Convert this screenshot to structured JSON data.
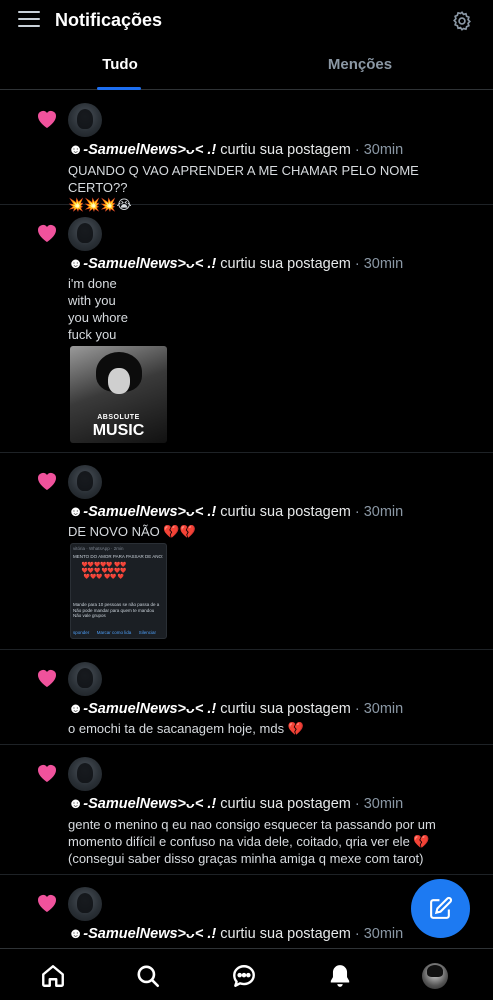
{
  "header": {
    "title": "Notificações",
    "menu_icon": "hamburger-menu-icon",
    "settings_icon": "gear-icon"
  },
  "tabs": [
    {
      "label": "Tudo",
      "active": true
    },
    {
      "label": "Menções",
      "active": false
    }
  ],
  "notifications": [
    {
      "user": "☻-SamuelNews˃ᴗ˂ .!",
      "action": " curtiu sua postagem",
      "time": " · 30min",
      "text": "QUANDO Q VAO APRENDER A ME CHAMAR PELO NOME CERTO??\n💥💥💥😭"
    },
    {
      "user": "☻-SamuelNews˃ᴗ˂ .!",
      "action": " curtiu sua postagem",
      "time": " · 30min",
      "text": "i'm done\nwith you\nyou whore\nfuck you",
      "media": {
        "small": "ABSOLUTE",
        "big": "MUSIC"
      }
    },
    {
      "user": "☻-SamuelNews˃ᴗ˂ .!",
      "action": " curtiu sua postagem",
      "time": " · 30min",
      "text": "DE NOVO NÃO 💔💔",
      "media": {
        "header": "vitória · WhatsApp · 2min",
        "line1": "MENTO DO AMOR PARA PASSAR DE ANO:",
        "hearts": "❤️❤️❤️❤️❤️ ❤️❤️❤️❤️❤️ ❤️❤️❤️❤️ ❤️❤️❤️ ❤️❤️ ❤️",
        "line2": "Mande para 10 pessoas se não passa de a\nNão pode mandar para quem te mandou\nNão vale grupos",
        "actions": "sponder      Marcar como lida      Silenciar"
      }
    },
    {
      "user": "☻-SamuelNews˃ᴗ˂ .!",
      "action": " curtiu sua postagem",
      "time": " · 30min",
      "text": "o emochi ta de sacanagem hoje, mds 💔"
    },
    {
      "user": "☻-SamuelNews˃ᴗ˂ .!",
      "action": " curtiu sua postagem",
      "time": " · 30min",
      "text": "gente o menino q eu nao consigo esquecer ta passando por um momento difícil e confuso na vida dele, coitado, qria ver ele 💔 (consegui saber disso graças minha amiga q mexe com tarot)"
    },
    {
      "user": "☻-SamuelNews˃ᴗ˂ .!",
      "action": " curtiu sua postagem",
      "time": " · 30min",
      "text": ""
    }
  ],
  "bottom_nav": [
    "home-icon",
    "search-icon",
    "chat-icon",
    "bell-icon",
    "profile-avatar"
  ],
  "fab_icon": "compose-icon",
  "colors": {
    "accent": "#1d7af2",
    "heart": "#f0529c",
    "background": "#000000"
  }
}
